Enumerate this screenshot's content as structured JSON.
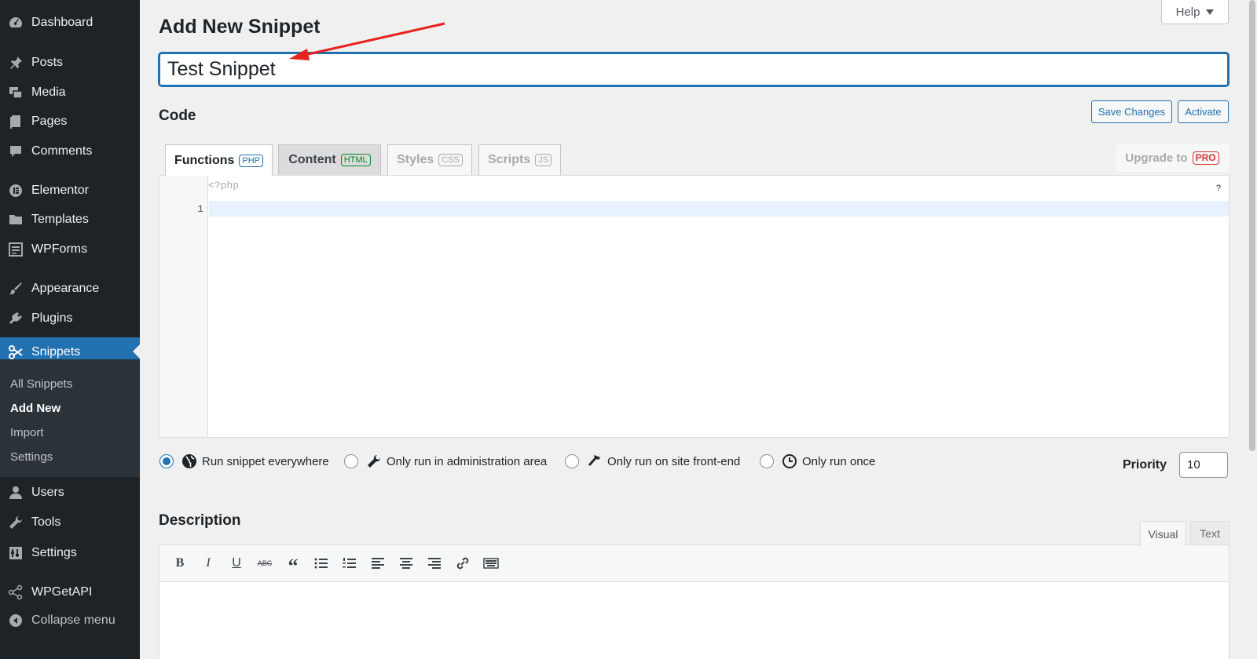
{
  "sidebar": {
    "items": [
      {
        "label": "Dashboard",
        "icon": "dashboard-icon"
      },
      {
        "label": "Posts",
        "icon": "pin-icon"
      },
      {
        "label": "Media",
        "icon": "media-icon"
      },
      {
        "label": "Pages",
        "icon": "pages-icon"
      },
      {
        "label": "Comments",
        "icon": "comments-icon"
      },
      {
        "label": "Elementor",
        "icon": "elementor-icon"
      },
      {
        "label": "Templates",
        "icon": "folder-icon"
      },
      {
        "label": "WPForms",
        "icon": "forms-icon"
      },
      {
        "label": "Appearance",
        "icon": "brush-icon"
      },
      {
        "label": "Plugins",
        "icon": "plugin-icon"
      },
      {
        "label": "Snippets",
        "icon": "scissors-icon"
      },
      {
        "label": "Users",
        "icon": "user-icon"
      },
      {
        "label": "Tools",
        "icon": "wrench-icon"
      },
      {
        "label": "Settings",
        "icon": "settings-icon"
      },
      {
        "label": "WPGetAPI",
        "icon": "api-icon"
      },
      {
        "label": "Collapse menu",
        "icon": "collapse-icon"
      }
    ],
    "submenu": [
      "All Snippets",
      "Add New",
      "Import",
      "Settings"
    ]
  },
  "header": {
    "title": "Add New Snippet",
    "help_label": "Help"
  },
  "snippet": {
    "title_value": "Test Snippet"
  },
  "code": {
    "heading": "Code",
    "save_label": "Save Changes",
    "activate_label": "Activate",
    "tabs": [
      {
        "label": "Functions",
        "badge": "PHP"
      },
      {
        "label": "Content",
        "badge": "HTML"
      },
      {
        "label": "Styles",
        "badge": "CSS"
      },
      {
        "label": "Scripts",
        "badge": "JS"
      }
    ],
    "upgrade_label": "Upgrade to",
    "upgrade_badge": "PRO",
    "php_open": "<?php",
    "line_number": "1",
    "help_mark": "?"
  },
  "scope": {
    "options": [
      {
        "label": "Run snippet everywhere",
        "icon": "globe-icon",
        "checked": true
      },
      {
        "label": "Only run in administration area",
        "icon": "wrench-icon",
        "checked": false
      },
      {
        "label": "Only run on site front-end",
        "icon": "hammer-icon",
        "checked": false
      },
      {
        "label": "Only run once",
        "icon": "clock-icon",
        "checked": false
      }
    ],
    "priority_label": "Priority",
    "priority_value": "10"
  },
  "description": {
    "heading": "Description",
    "visual_label": "Visual",
    "text_label": "Text",
    "toolbar": [
      "bold-icon",
      "italic-icon",
      "underline-icon",
      "strikethrough-icon",
      "blockquote-icon",
      "bullet-list-icon",
      "numbered-list-icon",
      "align-left-icon",
      "align-center-icon",
      "align-right-icon",
      "link-icon",
      "keyboard-icon"
    ]
  },
  "colors": {
    "accent": "#2271b1",
    "sidebar_bg": "#1d2327",
    "annotation_arrow": "#e8221f"
  }
}
